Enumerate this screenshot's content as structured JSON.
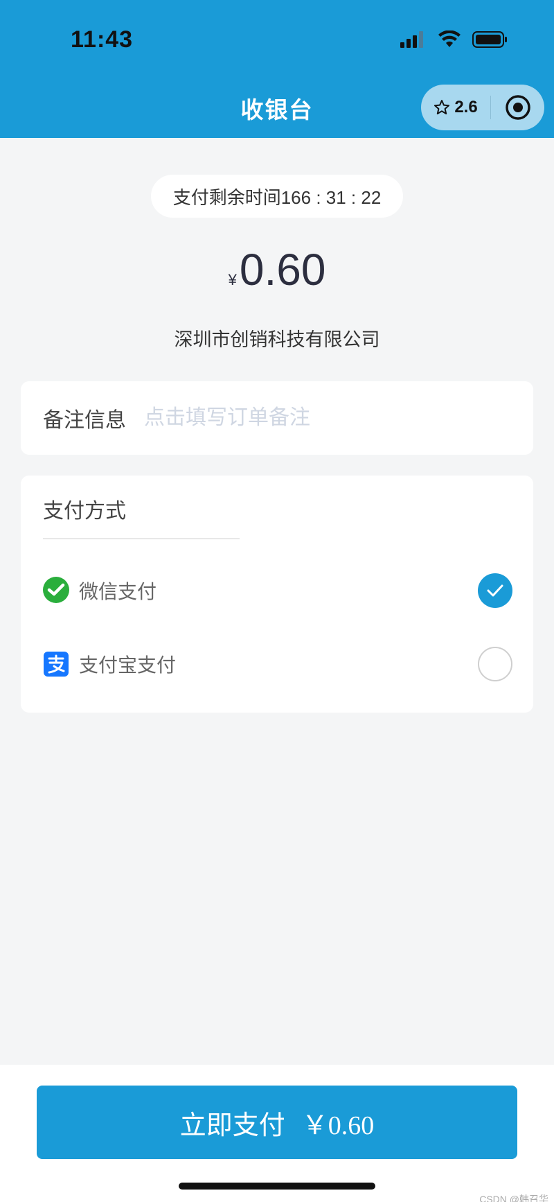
{
  "status_bar": {
    "time": "11:43"
  },
  "nav": {
    "title": "收银台",
    "capsule_rating": "2.6",
    "icons": [
      "star-outline-icon",
      "target-circle-icon"
    ]
  },
  "cashier": {
    "timer_text": "支付剩余时间166 : 31 : 22",
    "currency_symbol": "¥",
    "amount": "0.60",
    "merchant": "深圳市创销科技有限公司"
  },
  "remark": {
    "label": "备注信息",
    "placeholder": "点击填写订单备注",
    "value": ""
  },
  "payment": {
    "title": "支付方式",
    "methods": [
      {
        "label": "微信支付",
        "icon": "wechat-pay-icon",
        "selected": true
      },
      {
        "label": "支付宝支付",
        "icon": "alipay-icon",
        "selected": false
      }
    ]
  },
  "footer": {
    "pay_label": "立即支付",
    "pay_amount": "￥0.60",
    "watermark": "CSDN @韩召华"
  },
  "colors": {
    "brand_blue": "#1a9bd7",
    "capsule_bg": "#a8d8ef",
    "page_bg": "#f4f5f6",
    "wechat_green": "#2aae3c",
    "alipay_blue": "#1677ff"
  }
}
